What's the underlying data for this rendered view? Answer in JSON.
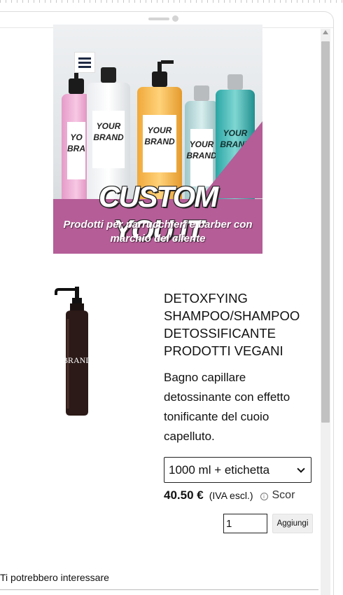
{
  "banner": {
    "brand_title": "CUSTOM YOU.IT",
    "subtitle": "Prodotti per parrucchieri e barber con marchio del cliente",
    "bottle_labels": [
      "YO BRA",
      "YOUR BRAND",
      "YOUR BRAND",
      "YOUR BRAND",
      "YOUR BRAND"
    ]
  },
  "nav": {
    "menu_icon": "hamburger-menu-icon"
  },
  "product": {
    "image_label": "BRAND",
    "title": "DETOXFYING SHAMPOO/SHAMPOO DETOSSIFICANTE PRODOTTI VEGANI",
    "description": "Bagno capillare detossinante con effetto tonificante del cuoio capelluto.",
    "variant_selected": "1000 ml + etichetta",
    "price": "40.50 €",
    "vat_note": "(IVA escl.)",
    "discount_label": "Scor",
    "quantity": "1",
    "add_button": "Aggiungi"
  },
  "related": {
    "heading": "Ti potrebbero interessare"
  },
  "colors": {
    "banner_magenta": "#b45d97",
    "bottle_dark": "#2b1a17"
  }
}
